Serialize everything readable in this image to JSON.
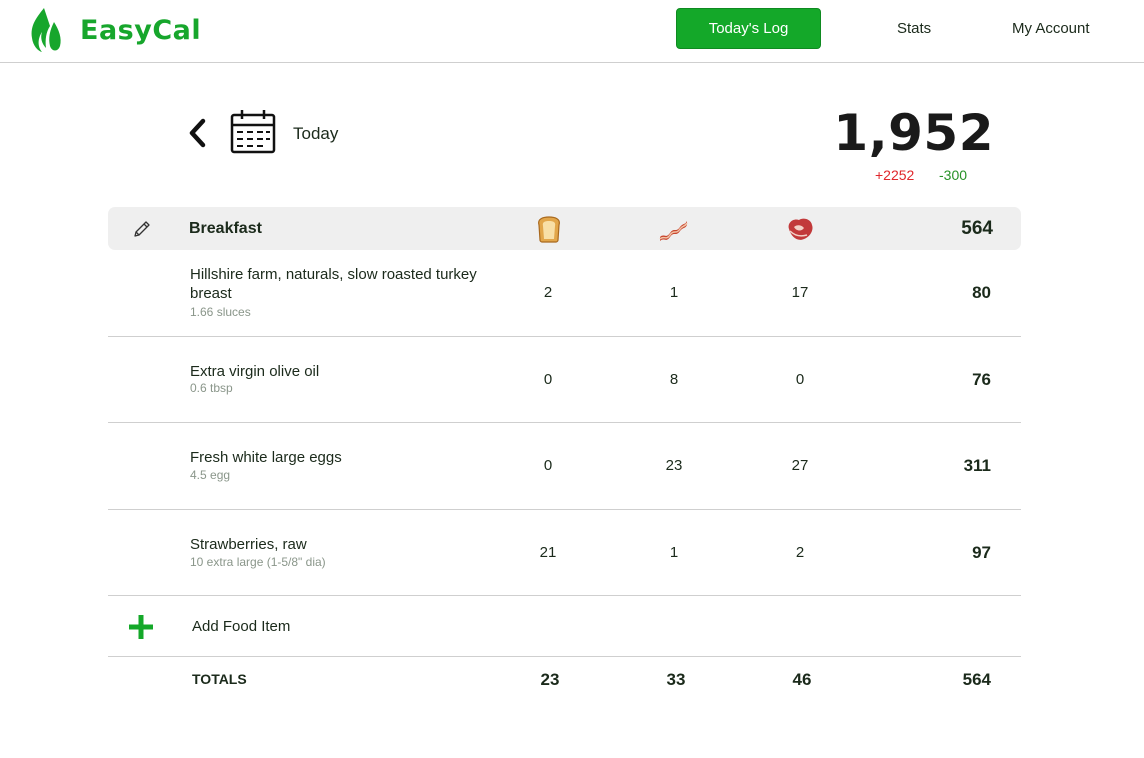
{
  "app": {
    "name": "EasyCal",
    "brand_color": "#14a829"
  },
  "nav": {
    "active_label": "Today's Log",
    "stats_label": "Stats",
    "account_label": "My Account"
  },
  "summary": {
    "date_label": "Today",
    "total_calories": "1,952",
    "delta_plus": "+2252",
    "delta_minus": "-300"
  },
  "meal": {
    "title": "Breakfast",
    "calories": "564",
    "macro_icons": [
      "bread-icon",
      "bacon-icon",
      "meat-icon"
    ],
    "items": [
      {
        "name": "Hillshire farm, naturals, slow roasted turkey breast",
        "amount": "1.66 sluces",
        "carbs": "2",
        "fat": "1",
        "protein": "17",
        "calories": "80"
      },
      {
        "name": "Extra virgin olive oil",
        "amount": "0.6 tbsp",
        "carbs": "0",
        "fat": "8",
        "protein": "0",
        "calories": "76"
      },
      {
        "name": "Fresh white large eggs",
        "amount": "4.5 egg",
        "carbs": "0",
        "fat": "23",
        "protein": "27",
        "calories": "311"
      },
      {
        "name": "Strawberries, raw",
        "amount": "10 extra large (1-5/8\" dia)",
        "carbs": "21",
        "fat": "1",
        "protein": "2",
        "calories": "97"
      }
    ],
    "add_label": "Add Food Item",
    "totals": {
      "label": "TOTALS",
      "carbs": "23",
      "fat": "33",
      "protein": "46",
      "calories": "564"
    }
  }
}
